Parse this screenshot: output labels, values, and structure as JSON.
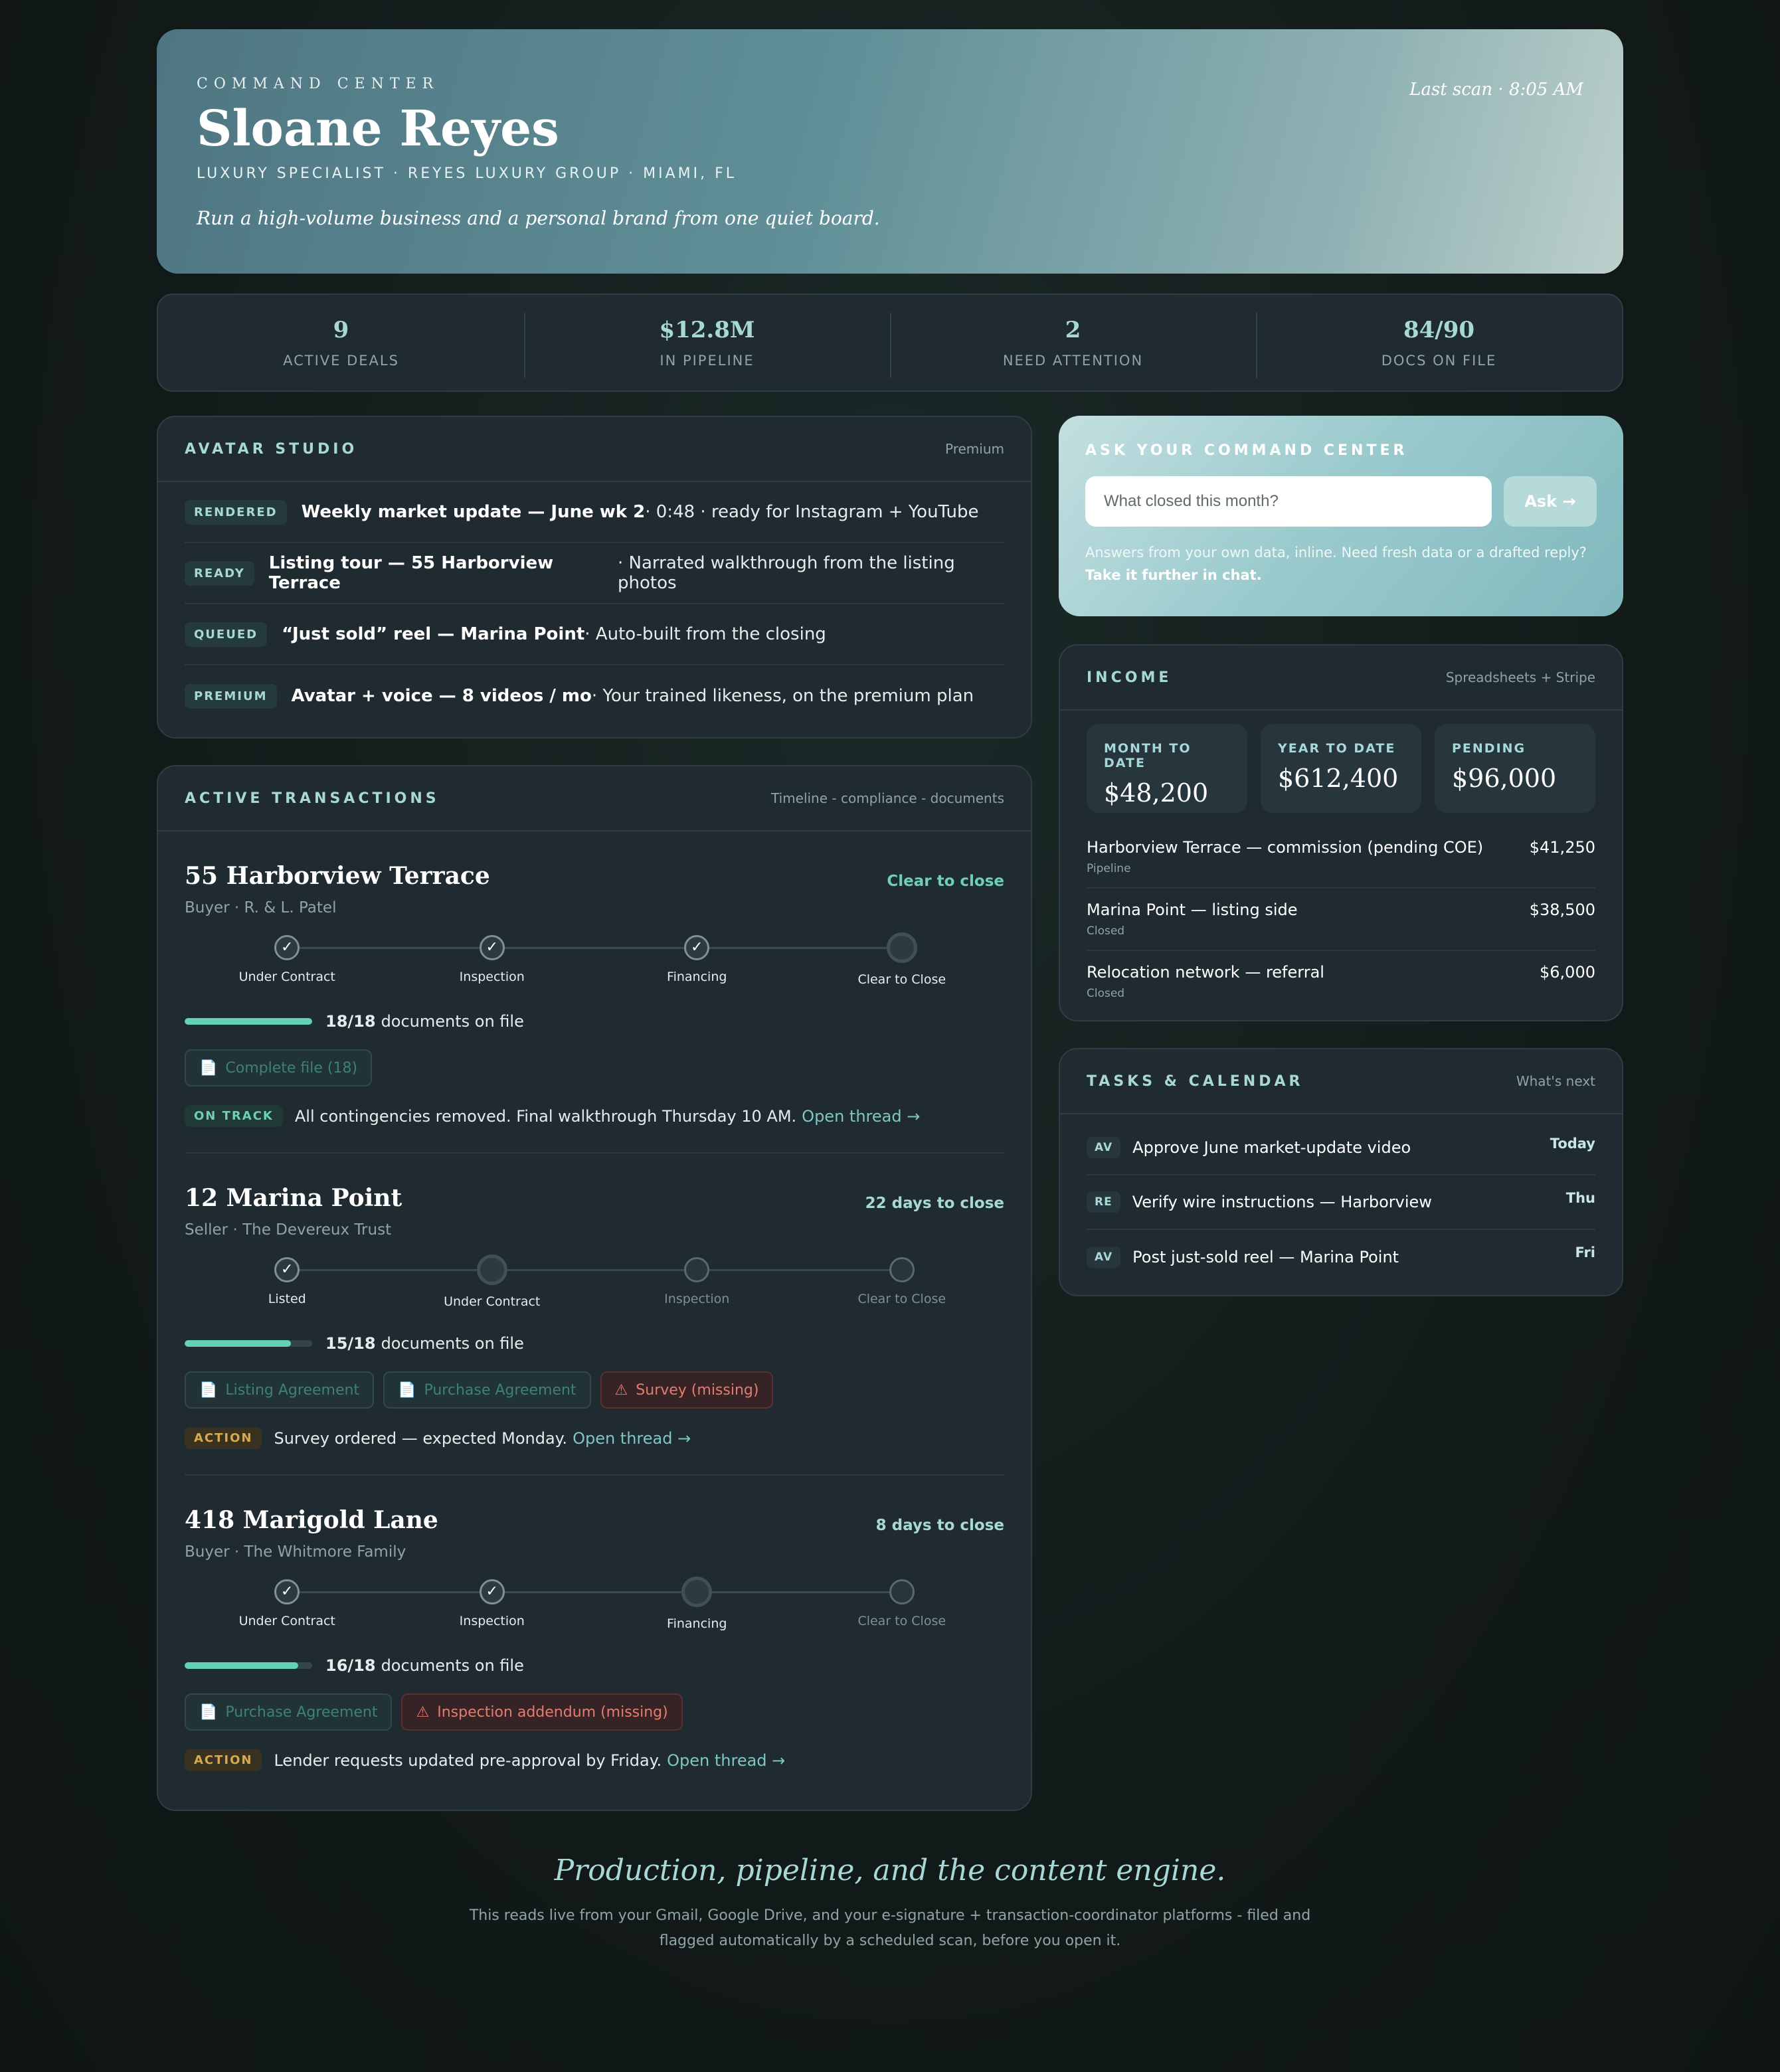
{
  "hero": {
    "kicker": "COMMAND CENTER",
    "name": "Sloane Reyes",
    "subtitle": "LUXURY SPECIALIST · REYES LUXURY GROUP · MIAMI, FL",
    "tagline": "Run a high-volume business and a personal brand from one quiet board.",
    "last_scan": "Last scan · 8:05 AM"
  },
  "stats": [
    {
      "value": "9",
      "label": "ACTIVE DEALS"
    },
    {
      "value": "$12.8M",
      "label": "IN PIPELINE"
    },
    {
      "value": "2",
      "label": "NEED ATTENTION"
    },
    {
      "value": "84/90",
      "label": "DOCS ON FILE"
    }
  ],
  "avatar_studio": {
    "title": "AVATAR STUDIO",
    "meta": "Premium",
    "items": [
      {
        "badge": "RENDERED",
        "title": "Weekly market update — June wk 2",
        "detail": " · 0:48 · ready for Instagram + YouTube"
      },
      {
        "badge": "READY",
        "title": "Listing tour — 55 Harborview Terrace",
        "detail": " · Narrated walkthrough from the listing photos"
      },
      {
        "badge": "QUEUED",
        "title": "“Just sold” reel — Marina Point",
        "detail": " · Auto-built from the closing"
      },
      {
        "badge": "PREMIUM",
        "title": "Avatar + voice — 8 videos / mo",
        "detail": " · Your trained likeness, on the premium plan"
      }
    ]
  },
  "transactions": {
    "title": "ACTIVE TRANSACTIONS",
    "meta": "Timeline - compliance - documents",
    "items": [
      {
        "title": "55 Harborview Terrace",
        "who": "Buyer · R. & L. Patel",
        "status": "Clear to close",
        "steps": [
          {
            "label": "Under Contract",
            "mark": "✓"
          },
          {
            "label": "Inspection",
            "mark": "✓"
          },
          {
            "label": "Financing",
            "mark": "✓"
          },
          {
            "label": "Clear to Close",
            "mark": ""
          }
        ],
        "docs_fraction": 1.0,
        "docs_count": "18/18",
        "docs_text": "documents on file",
        "chips": [
          {
            "icon": "📄",
            "label": "Complete file (18)"
          }
        ],
        "note_pill": "ON TRACK",
        "note_text": "All contingencies removed. Final walkthrough Thursday 10 AM.",
        "note_link": "Open thread →"
      },
      {
        "title": "12 Marina Point",
        "who": "Seller · The Devereux Trust",
        "status": "22 days to close",
        "steps": [
          {
            "label": "Listed",
            "mark": "✓"
          },
          {
            "label": "Under Contract",
            "mark": ""
          },
          {
            "label": "Inspection",
            "mark": ""
          },
          {
            "label": "Clear to Close",
            "mark": ""
          }
        ],
        "docs_fraction": 0.833,
        "docs_count": "15/18",
        "docs_text": "documents on file",
        "chips": [
          {
            "icon": "📄",
            "label": "Listing Agreement"
          },
          {
            "icon": "📄",
            "label": "Purchase Agreement"
          },
          {
            "icon": "⚠",
            "label": "Survey (missing)"
          }
        ],
        "note_pill": "ACTION",
        "note_text": "Survey ordered — expected Monday.",
        "note_link": "Open thread →"
      },
      {
        "title": "418 Marigold Lane",
        "who": "Buyer · The Whitmore Family",
        "status": "8 days to close",
        "steps": [
          {
            "label": "Under Contract",
            "mark": "✓"
          },
          {
            "label": "Inspection",
            "mark": "✓"
          },
          {
            "label": "Financing",
            "mark": ""
          },
          {
            "label": "Clear to Close",
            "mark": ""
          }
        ],
        "docs_fraction": 0.889,
        "docs_count": "16/18",
        "docs_text": "documents on file",
        "chips": [
          {
            "icon": "📄",
            "label": "Purchase Agreement"
          },
          {
            "icon": "⚠",
            "label": "Inspection addendum (missing)"
          }
        ],
        "note_pill": "ACTION",
        "note_text": "Lender requests updated pre-approval by Friday.",
        "note_link": "Open thread →"
      }
    ]
  },
  "ask": {
    "title": "ASK YOUR COMMAND CENTER",
    "placeholder": "What closed this month?",
    "button": "Ask →",
    "help": "Answers from your own data, inline. Need fresh data or a drafted reply?",
    "help_link": "Take it further in chat."
  },
  "income": {
    "title": "INCOME",
    "meta": "Spreadsheets + Stripe",
    "tiles": [
      {
        "label": "MONTH TO DATE",
        "value": "$48,200"
      },
      {
        "label": "YEAR TO DATE",
        "value": "$612,400"
      },
      {
        "label": "PENDING",
        "value": "$96,000"
      }
    ],
    "rows": [
      {
        "name": "Harborview Terrace — commission (pending COE)",
        "sub": "Pipeline",
        "amount": "$41,250"
      },
      {
        "name": "Marina Point — listing side",
        "sub": "Closed",
        "amount": "$38,500"
      },
      {
        "name": "Relocation network — referral",
        "sub": "Closed",
        "amount": "$6,000"
      }
    ]
  },
  "tasks": {
    "title": "TASKS & CALENDAR",
    "meta": "What's next",
    "items": [
      {
        "badge": "AV",
        "text": "Approve June market-update video",
        "when": "Today"
      },
      {
        "badge": "RE",
        "text": "Verify wire instructions — Harborview",
        "when": "Thu"
      },
      {
        "badge": "AV",
        "text": "Post just-sold reel — Marina Point",
        "when": "Fri"
      }
    ]
  },
  "footer": {
    "tagline": "Production, pipeline, and the content engine.",
    "text": "This reads live from your Gmail, Google Drive, and your e-signature + transaction-coordinator platforms - filed and flagged automatically by a scheduled scan, before you open it."
  }
}
